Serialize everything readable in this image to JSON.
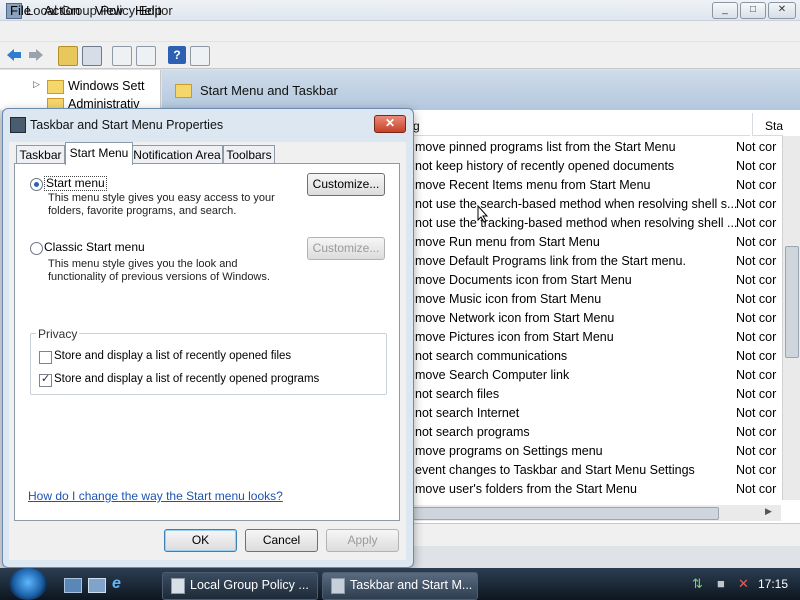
{
  "window": {
    "title": "Local Group Policy Editor",
    "min": "_",
    "max": "□",
    "close": "✕"
  },
  "menu": {
    "file": "File",
    "action": "Action",
    "view": "View",
    "help": "Help"
  },
  "tree": {
    "items": [
      "Windows Sett",
      "Administrativ"
    ]
  },
  "rightpane": {
    "title": "Start Menu and Taskbar",
    "col_setting": "g",
    "col_state": "Sta",
    "rows": [
      {
        "setting": "move pinned programs list from the Start Menu",
        "state": "Not cor"
      },
      {
        "setting": "not keep history of recently opened documents",
        "state": "Not cor"
      },
      {
        "setting": "move Recent Items menu from Start Menu",
        "state": "Not cor"
      },
      {
        "setting": "not use the search-based method when resolving shell s...",
        "state": "Not cor"
      },
      {
        "setting": "not use the tracking-based method when resolving shell ...",
        "state": "Not cor"
      },
      {
        "setting": "move Run menu from Start Menu",
        "state": "Not cor"
      },
      {
        "setting": "move Default Programs link from the Start menu.",
        "state": "Not cor"
      },
      {
        "setting": "move Documents icon from Start Menu",
        "state": "Not cor"
      },
      {
        "setting": "move Music icon from Start Menu",
        "state": "Not cor"
      },
      {
        "setting": "move Network icon from Start Menu",
        "state": "Not cor"
      },
      {
        "setting": "move Pictures icon from Start Menu",
        "state": "Not cor"
      },
      {
        "setting": "not search communications",
        "state": "Not cor"
      },
      {
        "setting": "move Search Computer link",
        "state": "Not cor"
      },
      {
        "setting": "not search files",
        "state": "Not cor"
      },
      {
        "setting": "not search Internet",
        "state": "Not cor"
      },
      {
        "setting": "not search programs",
        "state": "Not cor"
      },
      {
        "setting": "move programs on Settings menu",
        "state": "Not cor"
      },
      {
        "setting": "event changes to Taskbar and Start Menu Settings",
        "state": "Not cor"
      },
      {
        "setting": "move user's folders from the Start Menu",
        "state": "Not cor"
      }
    ]
  },
  "dialog": {
    "title": "Taskbar and Start Menu Properties",
    "tabs": [
      "Taskbar",
      "Start Menu",
      "Notification Area",
      "Toolbars"
    ],
    "start_menu": {
      "label": "Start menu",
      "desc": "This menu style gives you easy access to your folders, favorite programs, and search."
    },
    "classic": {
      "label": "Classic Start menu",
      "desc": "This menu style gives you the look and functionality of previous versions of Windows."
    },
    "customize": "Customize...",
    "privacy": {
      "legend": "Privacy",
      "files": "Store and display a list of recently opened files",
      "programs": "Store and display a list of recently opened programs"
    },
    "link": "How do I change the way the Start menu looks?",
    "ok": "OK",
    "cancel": "Cancel",
    "apply": "Apply"
  },
  "taskbar": {
    "items": [
      "Local Group Policy ...",
      "Taskbar and Start M..."
    ],
    "clock": "17:15"
  },
  "colors": {
    "accent": "#1d54b3",
    "taskbar": "#0d1620",
    "header": "#b3c7dd"
  }
}
